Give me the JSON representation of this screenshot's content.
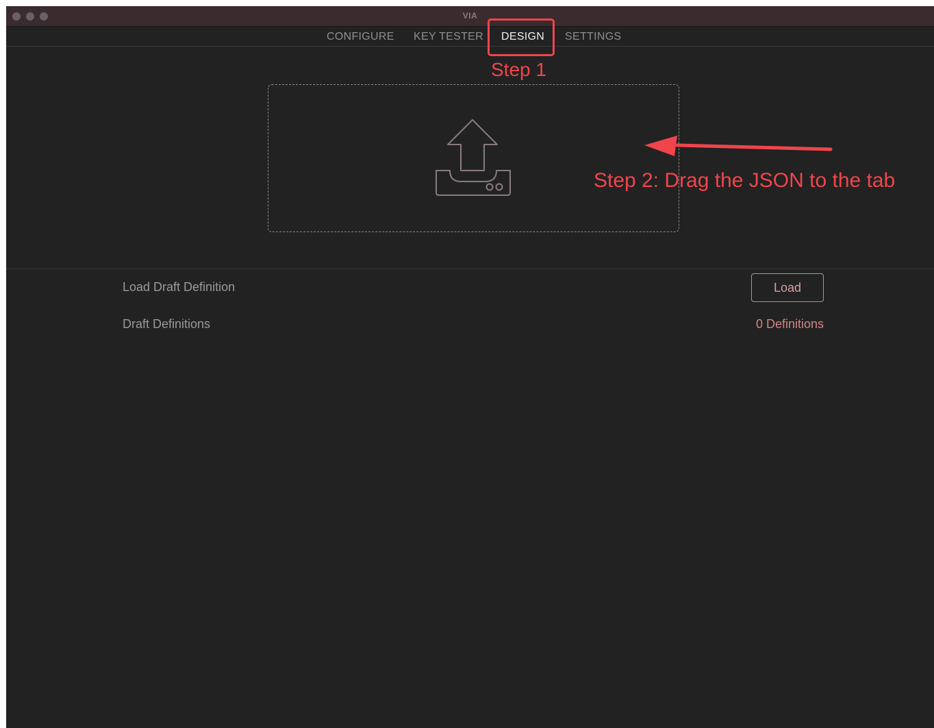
{
  "window": {
    "title": "VIA"
  },
  "tabs": [
    {
      "label": "CONFIGURE",
      "active": false
    },
    {
      "label": "KEY TESTER",
      "active": false
    },
    {
      "label": "DESIGN",
      "active": true
    },
    {
      "label": "SETTINGS",
      "active": false
    }
  ],
  "dropzone": {
    "icon": "upload-icon"
  },
  "settings": {
    "load_draft_label": "Load Draft Definition",
    "load_button_label": "Load",
    "draft_definitions_label": "Draft Definitions",
    "draft_definitions_value": "0 Definitions"
  },
  "annotations": {
    "step1": "Step 1",
    "step2": "Step 2: Drag the JSON to the tab"
  },
  "colors": {
    "background": "#222222",
    "titlebar": "#3b2b2f",
    "accent": "#d58585",
    "annotation": "#f0454b"
  }
}
